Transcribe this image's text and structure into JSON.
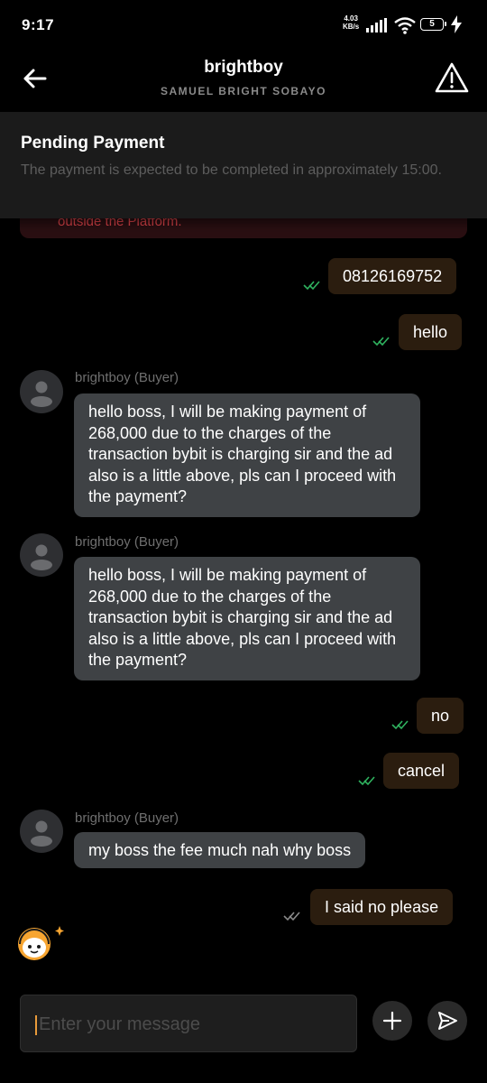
{
  "status": {
    "time": "9:17",
    "speed_value": "4.03",
    "speed_unit": "KB/s",
    "battery": "5"
  },
  "header": {
    "title": "brightboy",
    "subtitle": "SAMUEL BRIGHT SOBAYO"
  },
  "banner": {
    "title": "Pending Payment",
    "description": "The payment is expected to be completed in approximately 15:00."
  },
  "warning": {
    "text": "outside the Platform."
  },
  "messages": [
    {
      "text": "08126169752"
    },
    {
      "text": "hello"
    },
    {
      "sender": "brightboy (Buyer)",
      "text": "hello boss, I will be making payment of 268,000 due to the charges of the transaction bybit is charging sir and the ad also is a little above, pls can I proceed with the payment?"
    },
    {
      "sender": "brightboy (Buyer)",
      "text": "hello boss, I will be making payment of 268,000 due to the charges of the transaction bybit is charging sir and the ad also is a little above, pls can I proceed with the payment?"
    },
    {
      "text": "no"
    },
    {
      "text": "cancel"
    },
    {
      "sender": "brightboy (Buyer)",
      "text": "my boss the fee much nah why boss"
    },
    {
      "text": "I said no please"
    }
  ],
  "composer": {
    "placeholder": "Enter your message"
  },
  "colors": {
    "outgoing_bubble": "#2b1d0f",
    "incoming_bubble": "#3f4245",
    "read_check": "#2fb35f",
    "unread_check": "#8a8a8a",
    "warning_text": "#e0444a"
  }
}
